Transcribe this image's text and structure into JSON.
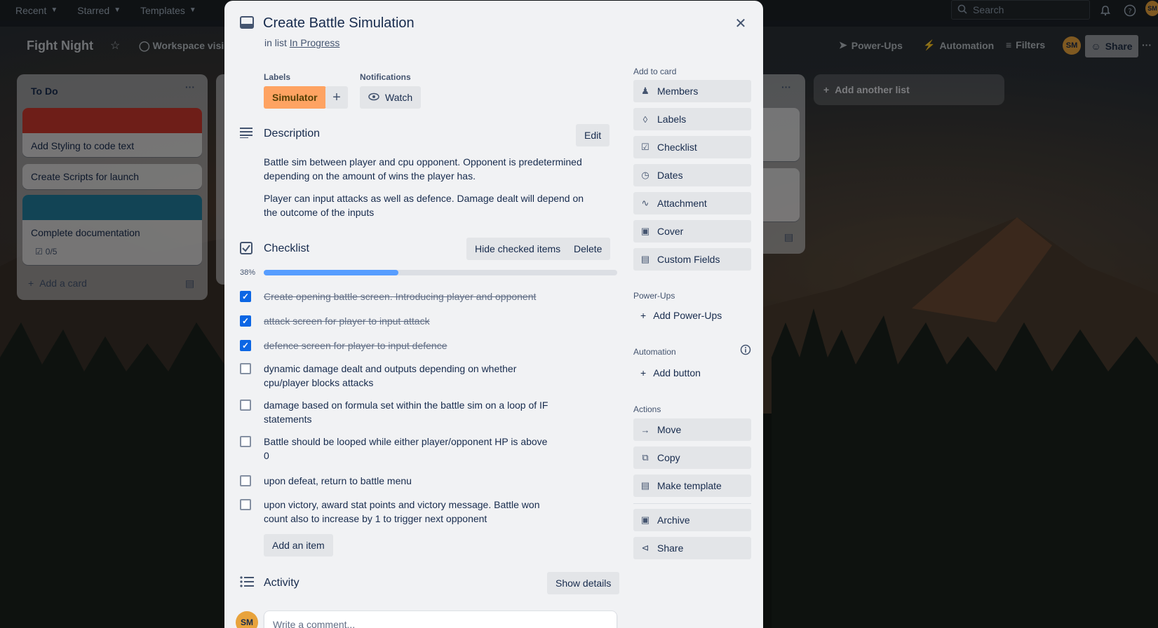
{
  "topnav": {
    "recent": "Recent",
    "starred": "Starred",
    "templates": "Templates",
    "search_placeholder": "Search"
  },
  "board": {
    "title": "Fight Night",
    "workspace_visibility": "Workspace visib",
    "power_ups": "Power-Ups",
    "automation": "Automation",
    "filters": "Filters",
    "avatar_initials": "SM",
    "share": "Share",
    "add_another_list": "Add another list"
  },
  "lists": {
    "todo": {
      "title": "To Do",
      "cards": [
        {
          "text": "Add Styling to code text",
          "cover": "#c9372c"
        },
        {
          "text": "Create Scripts for launch"
        },
        {
          "text": "Complete documentation",
          "cover": "#227d9b",
          "checklist": "0/5"
        }
      ],
      "add_card": "Add a card"
    }
  },
  "modal": {
    "title": "Create Battle Simulation",
    "in_list_prefix": "in list",
    "list_name": "In Progress",
    "labels_heading": "Labels",
    "label_chip": "Simulator",
    "notifications_heading": "Notifications",
    "watch": "Watch",
    "description": {
      "title": "Description",
      "edit": "Edit",
      "para1": "Battle sim between player and cpu opponent. Opponent is predetermined depending on the amount of wins the player has.",
      "para2": "Player can input attacks as well as defence. Damage dealt will depend on the outcome of the inputs"
    },
    "checklist": {
      "title": "Checklist",
      "hide_checked": "Hide checked items",
      "delete": "Delete",
      "percent_label": "38%",
      "progress": 0.38,
      "items": [
        {
          "text": "Create opening battle screen. Introducing player and opponent",
          "checked": true
        },
        {
          "text": "attack screen for player to input attack",
          "checked": true
        },
        {
          "text": "defence screen for player to input defence",
          "checked": true
        },
        {
          "text": "dynamic damage dealt and outputs depending on whether cpu/player blocks attacks",
          "checked": false
        },
        {
          "text": "damage based on formula set within the battle sim on a loop of IF statements",
          "checked": false
        },
        {
          "text": "Battle should be looped while either player/opponent HP is above 0",
          "checked": false
        },
        {
          "text": "upon defeat, return to battle menu",
          "checked": false
        },
        {
          "text": "upon victory, award stat points and victory message. Battle won count also to increase by 1 to trigger next opponent",
          "checked": false
        }
      ],
      "add_item": "Add an item"
    },
    "activity": {
      "title": "Activity",
      "show_details": "Show details",
      "avatar_initials": "SM",
      "comment_placeholder": "Write a comment..."
    },
    "sidebar": {
      "add_to_card": "Add to card",
      "members": "Members",
      "labels": "Labels",
      "checklist": "Checklist",
      "dates": "Dates",
      "attachment": "Attachment",
      "cover": "Cover",
      "custom_fields": "Custom Fields",
      "power_ups_heading": "Power-Ups",
      "add_power_ups": "Add Power-Ups",
      "automation_heading": "Automation",
      "add_button": "Add button",
      "actions_heading": "Actions",
      "move": "Move",
      "copy": "Copy",
      "make_template": "Make template",
      "archive": "Archive",
      "share": "Share"
    }
  },
  "colors": {
    "label_orange": "#fea362",
    "progress_blue": "#579dff",
    "checkbox_blue": "#0c66e4",
    "avatar": "#e8a33c"
  }
}
